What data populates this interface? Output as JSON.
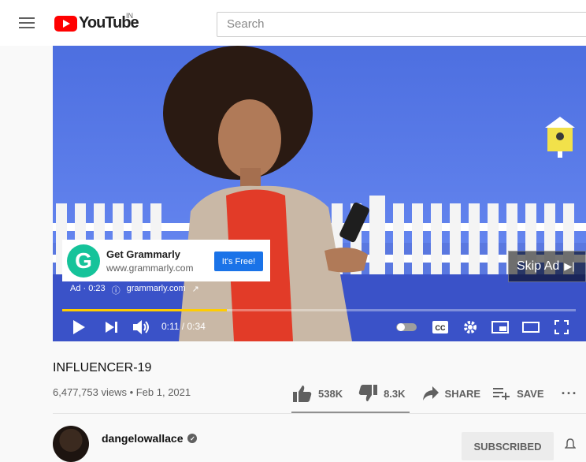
{
  "header": {
    "logo_text": "YouTube",
    "country": "IN",
    "search_placeholder": "Search"
  },
  "player": {
    "ad": {
      "title": "Get Grammarly",
      "url": "www.grammarly.com",
      "cta": "It's Free!",
      "logo_letter": "G",
      "label": "Ad · 0:23",
      "domain": "grammarly.com",
      "skip_label": "Skip Ad"
    },
    "time_display": "0:11 / 0:34",
    "progress_fraction": 0.32,
    "colors": {
      "progress": "#ffcc00",
      "cta": "#1a73e8",
      "grammarly": "#15c39a"
    }
  },
  "video": {
    "title": "INFLUENCER-19",
    "views_date": "6,477,753 views • Feb 1, 2021",
    "likes": "538K",
    "dislikes": "8.3K",
    "share_label": "SHARE",
    "save_label": "SAVE"
  },
  "channel": {
    "name": "dangelowallace",
    "subscribe_label": "SUBSCRIBED"
  }
}
